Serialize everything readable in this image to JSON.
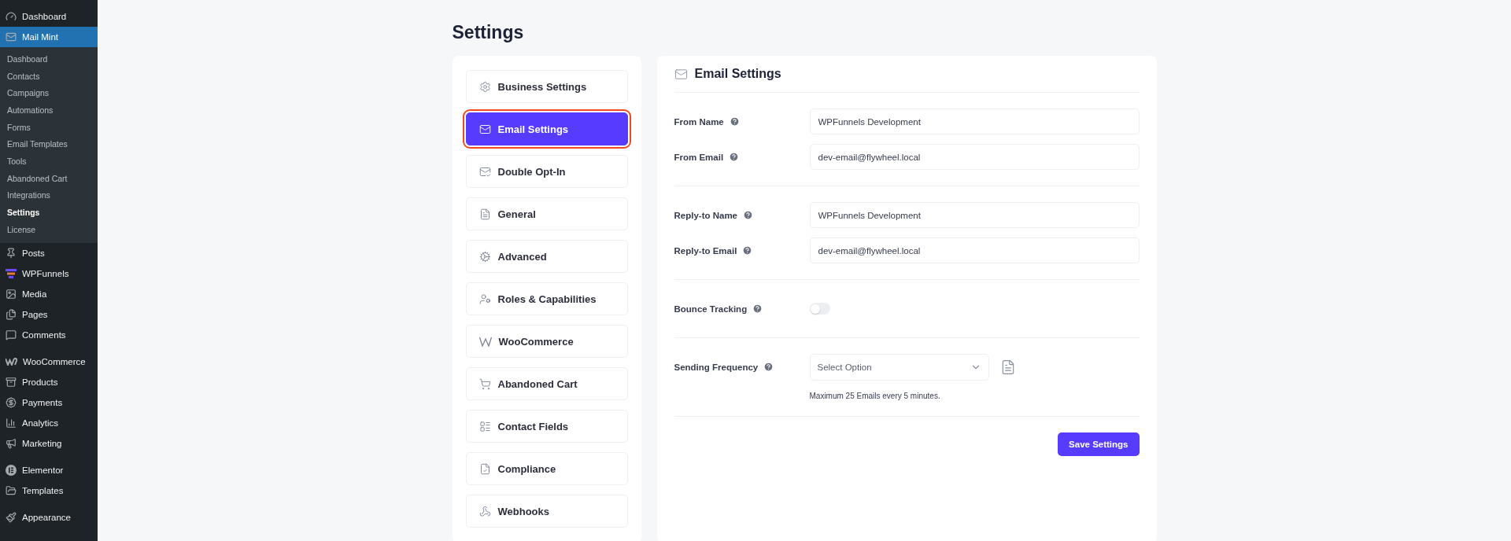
{
  "admin_menu": {
    "groups": [
      {
        "items": [
          {
            "label": "Dashboard",
            "selected": false
          },
          {
            "label": "Mail Mint",
            "selected": true,
            "children": [
              {
                "label": "Dashboard",
                "selected": false
              },
              {
                "label": "Contacts",
                "selected": false
              },
              {
                "label": "Campaigns",
                "selected": false
              },
              {
                "label": "Automations",
                "selected": false
              },
              {
                "label": "Forms",
                "selected": false
              },
              {
                "label": "Email Templates",
                "selected": false
              },
              {
                "label": "Tools",
                "selected": false
              },
              {
                "label": "Abandoned Cart",
                "selected": false
              },
              {
                "label": "Integrations",
                "selected": false
              },
              {
                "label": "Settings",
                "selected": true
              },
              {
                "label": "License",
                "selected": false
              }
            ]
          },
          {
            "label": "Posts",
            "selected": false
          },
          {
            "label": "WPFunnels",
            "selected": false
          },
          {
            "label": "Media",
            "selected": false
          },
          {
            "label": "Pages",
            "selected": false
          },
          {
            "label": "Comments",
            "selected": false
          }
        ]
      },
      {
        "items": [
          {
            "label": "WooCommerce",
            "selected": false
          },
          {
            "label": "Products",
            "selected": false
          },
          {
            "label": "Payments",
            "selected": false
          },
          {
            "label": "Analytics",
            "selected": false
          },
          {
            "label": "Marketing",
            "selected": false
          }
        ]
      },
      {
        "items": [
          {
            "label": "Elementor",
            "selected": false
          },
          {
            "label": "Templates",
            "selected": false
          }
        ]
      },
      {
        "items": [
          {
            "label": "Appearance",
            "selected": false
          }
        ]
      }
    ]
  },
  "page_title": "Settings",
  "settings_nav": [
    {
      "label": "Business Settings",
      "selected": false
    },
    {
      "label": "Email Settings",
      "selected": true
    },
    {
      "label": "Double Opt-In",
      "selected": false
    },
    {
      "label": "General",
      "selected": false
    },
    {
      "label": "Advanced",
      "selected": false
    },
    {
      "label": "Roles & Capabilities",
      "selected": false
    },
    {
      "label": "WooCommerce",
      "selected": false
    },
    {
      "label": "Abandoned Cart",
      "selected": false
    },
    {
      "label": "Contact Fields",
      "selected": false
    },
    {
      "label": "Compliance",
      "selected": false
    },
    {
      "label": "Webhooks",
      "selected": false
    }
  ],
  "panel": {
    "title": "Email Settings",
    "sections": [
      {
        "fields": [
          {
            "kind": "text",
            "label": "From Name",
            "value": "WPFunnels Development"
          },
          {
            "kind": "text",
            "label": "From Email",
            "value": "dev-email@flywheel.local"
          }
        ]
      },
      {
        "fields": [
          {
            "kind": "text",
            "label": "Reply-to Name",
            "value": "WPFunnels Development"
          },
          {
            "kind": "text",
            "label": "Reply-to Email",
            "value": "dev-email@flywheel.local"
          }
        ]
      },
      {
        "fields": [
          {
            "kind": "toggle",
            "label": "Bounce Tracking",
            "on": false
          }
        ]
      },
      {
        "fields": [
          {
            "kind": "select",
            "label": "Sending Frequency",
            "placeholder": "Select Option",
            "note": "Maximum 25 Emails every 5 minutes."
          }
        ]
      }
    ],
    "save_button": "Save Settings"
  }
}
